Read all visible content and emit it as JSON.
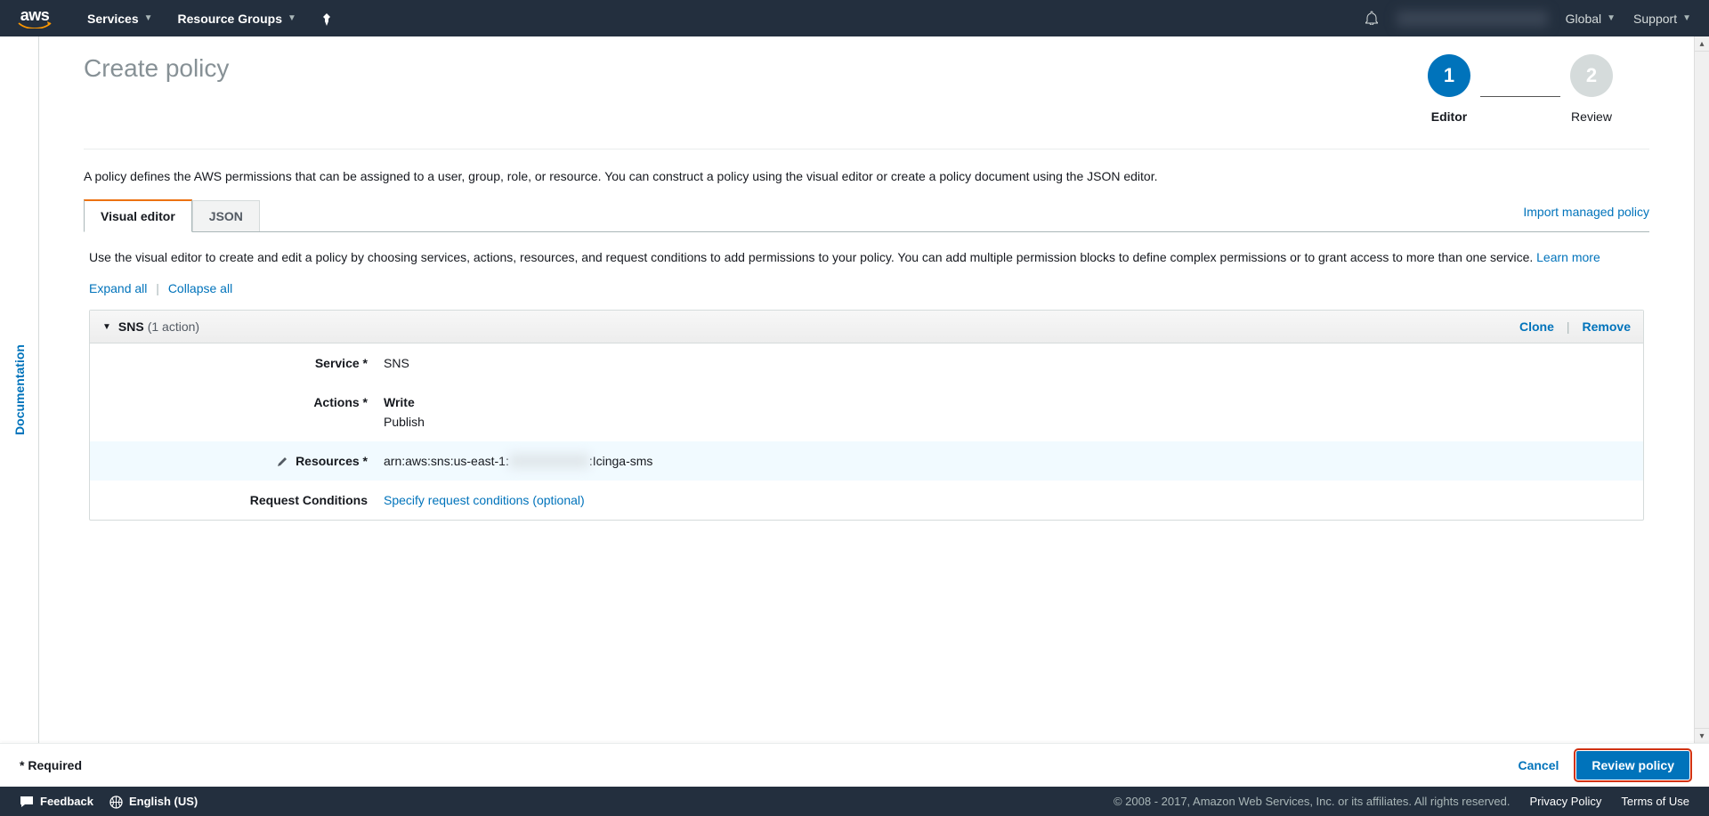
{
  "topnav": {
    "logo_text": "aws",
    "services": "Services",
    "resource_groups": "Resource Groups",
    "region": "Global",
    "support": "Support"
  },
  "sidebar": {
    "documentation": "Documentation"
  },
  "page": {
    "title": "Create policy",
    "wizard": {
      "step1_num": "1",
      "step1_label": "Editor",
      "step2_num": "2",
      "step2_label": "Review"
    },
    "intro": "A policy defines the AWS permissions that can be assigned to a user, group, role, or resource. You can construct a policy using the visual editor or create a policy document using the JSON editor.",
    "tabs": {
      "visual": "Visual editor",
      "json": "JSON"
    },
    "import_link": "Import managed policy",
    "visual_desc": "Use the visual editor to create and edit a policy by choosing services, actions, resources, and request conditions to add permissions to your policy. You can add multiple permission blocks to define complex permissions or to grant access to more than one service. ",
    "learn_more": "Learn more",
    "expand_all": "Expand all",
    "collapse_all": "Collapse all",
    "block": {
      "title": "SNS",
      "subtitle": "(1 action)",
      "clone": "Clone",
      "remove": "Remove",
      "rows": {
        "service_label": "Service *",
        "service_value": "SNS",
        "actions_label": "Actions *",
        "actions_group": "Write",
        "actions_value": "Publish",
        "resources_label": "Resources *",
        "resources_prefix": "arn:aws:sns:us-east-1:",
        "resources_suffix": "Icinga-sms",
        "conditions_label": "Request Conditions",
        "conditions_link": "Specify request conditions (optional)"
      }
    }
  },
  "actionbar": {
    "required": "* Required",
    "cancel": "Cancel",
    "review": "Review policy"
  },
  "footer": {
    "feedback": "Feedback",
    "language": "English (US)",
    "copyright": "© 2008 - 2017, Amazon Web Services, Inc. or its affiliates. All rights reserved.",
    "privacy": "Privacy Policy",
    "terms": "Terms of Use"
  }
}
